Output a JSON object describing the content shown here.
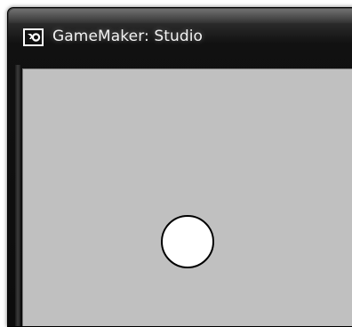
{
  "window": {
    "title": "GameMaker: Studio",
    "icon": "gamemaker-logo-icon"
  },
  "room": {
    "background_color": "#c0c0c0",
    "objects": [
      {
        "type": "circle",
        "fill": "#ffffff",
        "stroke": "#000000"
      }
    ]
  }
}
